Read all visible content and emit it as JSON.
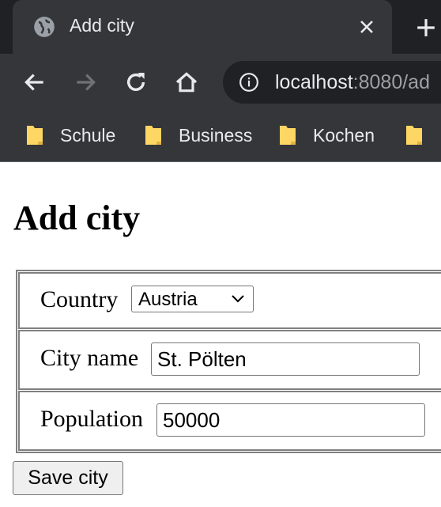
{
  "browser": {
    "tab": {
      "title": "Add city",
      "icon": "globe-icon"
    },
    "url": {
      "host": "localhost",
      "rest": ":8080/ad"
    },
    "bookmarks": [
      {
        "label": "Schule"
      },
      {
        "label": "Business"
      },
      {
        "label": "Kochen"
      }
    ]
  },
  "page": {
    "title": "Add city",
    "form": {
      "country_label": "Country",
      "country_value": "Austria",
      "city_label": "City name",
      "city_value": "St. Pölten",
      "population_label": "Population",
      "population_value": "50000",
      "save_label": "Save city"
    }
  },
  "colors": {
    "chrome_dark": "#202124",
    "chrome_mid": "#35363a",
    "chrome_text": "#e8eaed",
    "folder_yellow": "#fdd663",
    "table_border": "#808080"
  }
}
